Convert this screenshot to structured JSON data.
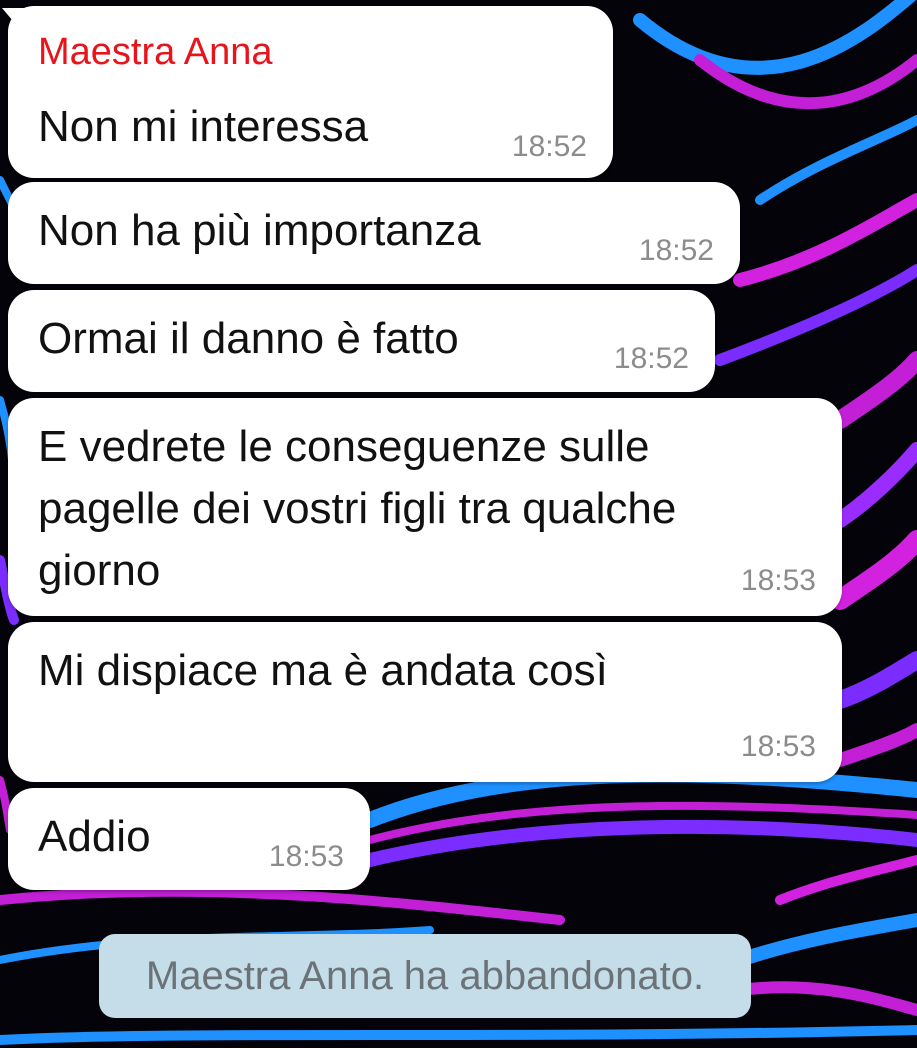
{
  "colors": {
    "bubble_bg": "#ffffff",
    "sender_name": "#e8141b",
    "timestamp": "#8c8c8c",
    "service_bg": "#c5dde9",
    "service_text": "#6b7378",
    "wallpaper_accents": [
      "#1e90ff",
      "#c21fd6",
      "#7b2cff"
    ]
  },
  "messages": [
    {
      "sender": "Maestra Anna",
      "text": "Non mi interessa",
      "time": "18:52"
    },
    {
      "text": "Non ha più importanza",
      "time": "18:52"
    },
    {
      "text": "Ormai il danno è fatto",
      "time": "18:52"
    },
    {
      "text": "E vedrete le conseguenze sulle\npagelle dei vostri figli tra qualche\ngiorno",
      "time": "18:53"
    },
    {
      "text": "Mi dispiace ma è andata così",
      "time": "18:53"
    },
    {
      "text": "Addio",
      "time": "18:53"
    }
  ],
  "service_message": "Maestra Anna ha abbandonato."
}
